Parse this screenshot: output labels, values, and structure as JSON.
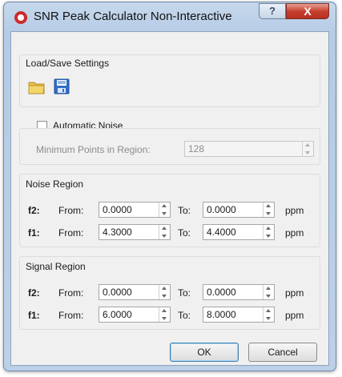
{
  "window": {
    "title": "SNR Peak Calculator Non-Interactive",
    "help_label": "?",
    "close_label": "X"
  },
  "load_save": {
    "title": "Load/Save Settings",
    "icons": [
      "folder-icon",
      "save-icon"
    ]
  },
  "auto_noise": {
    "label": "Automatic Noise",
    "checked": false,
    "min_points_label": "Minimum Points in Region:",
    "min_points_value": "128"
  },
  "noise_region": {
    "title": "Noise Region",
    "rows": [
      {
        "dim": "f2:",
        "from_label": "From:",
        "from": "0.0000",
        "to_label": "To:",
        "to": "0.0000",
        "unit": "ppm"
      },
      {
        "dim": "f1:",
        "from_label": "From:",
        "from": "4.3000",
        "to_label": "To:",
        "to": "4.4000",
        "unit": "ppm"
      }
    ]
  },
  "signal_region": {
    "title": "Signal Region",
    "rows": [
      {
        "dim": "f2:",
        "from_label": "From:",
        "from": "0.0000",
        "to_label": "To:",
        "to": "0.0000",
        "unit": "ppm"
      },
      {
        "dim": "f1:",
        "from_label": "From:",
        "from": "6.0000",
        "to_label": "To:",
        "to": "8.0000",
        "unit": "ppm"
      }
    ]
  },
  "buttons": {
    "ok": "OK",
    "cancel": "Cancel"
  }
}
